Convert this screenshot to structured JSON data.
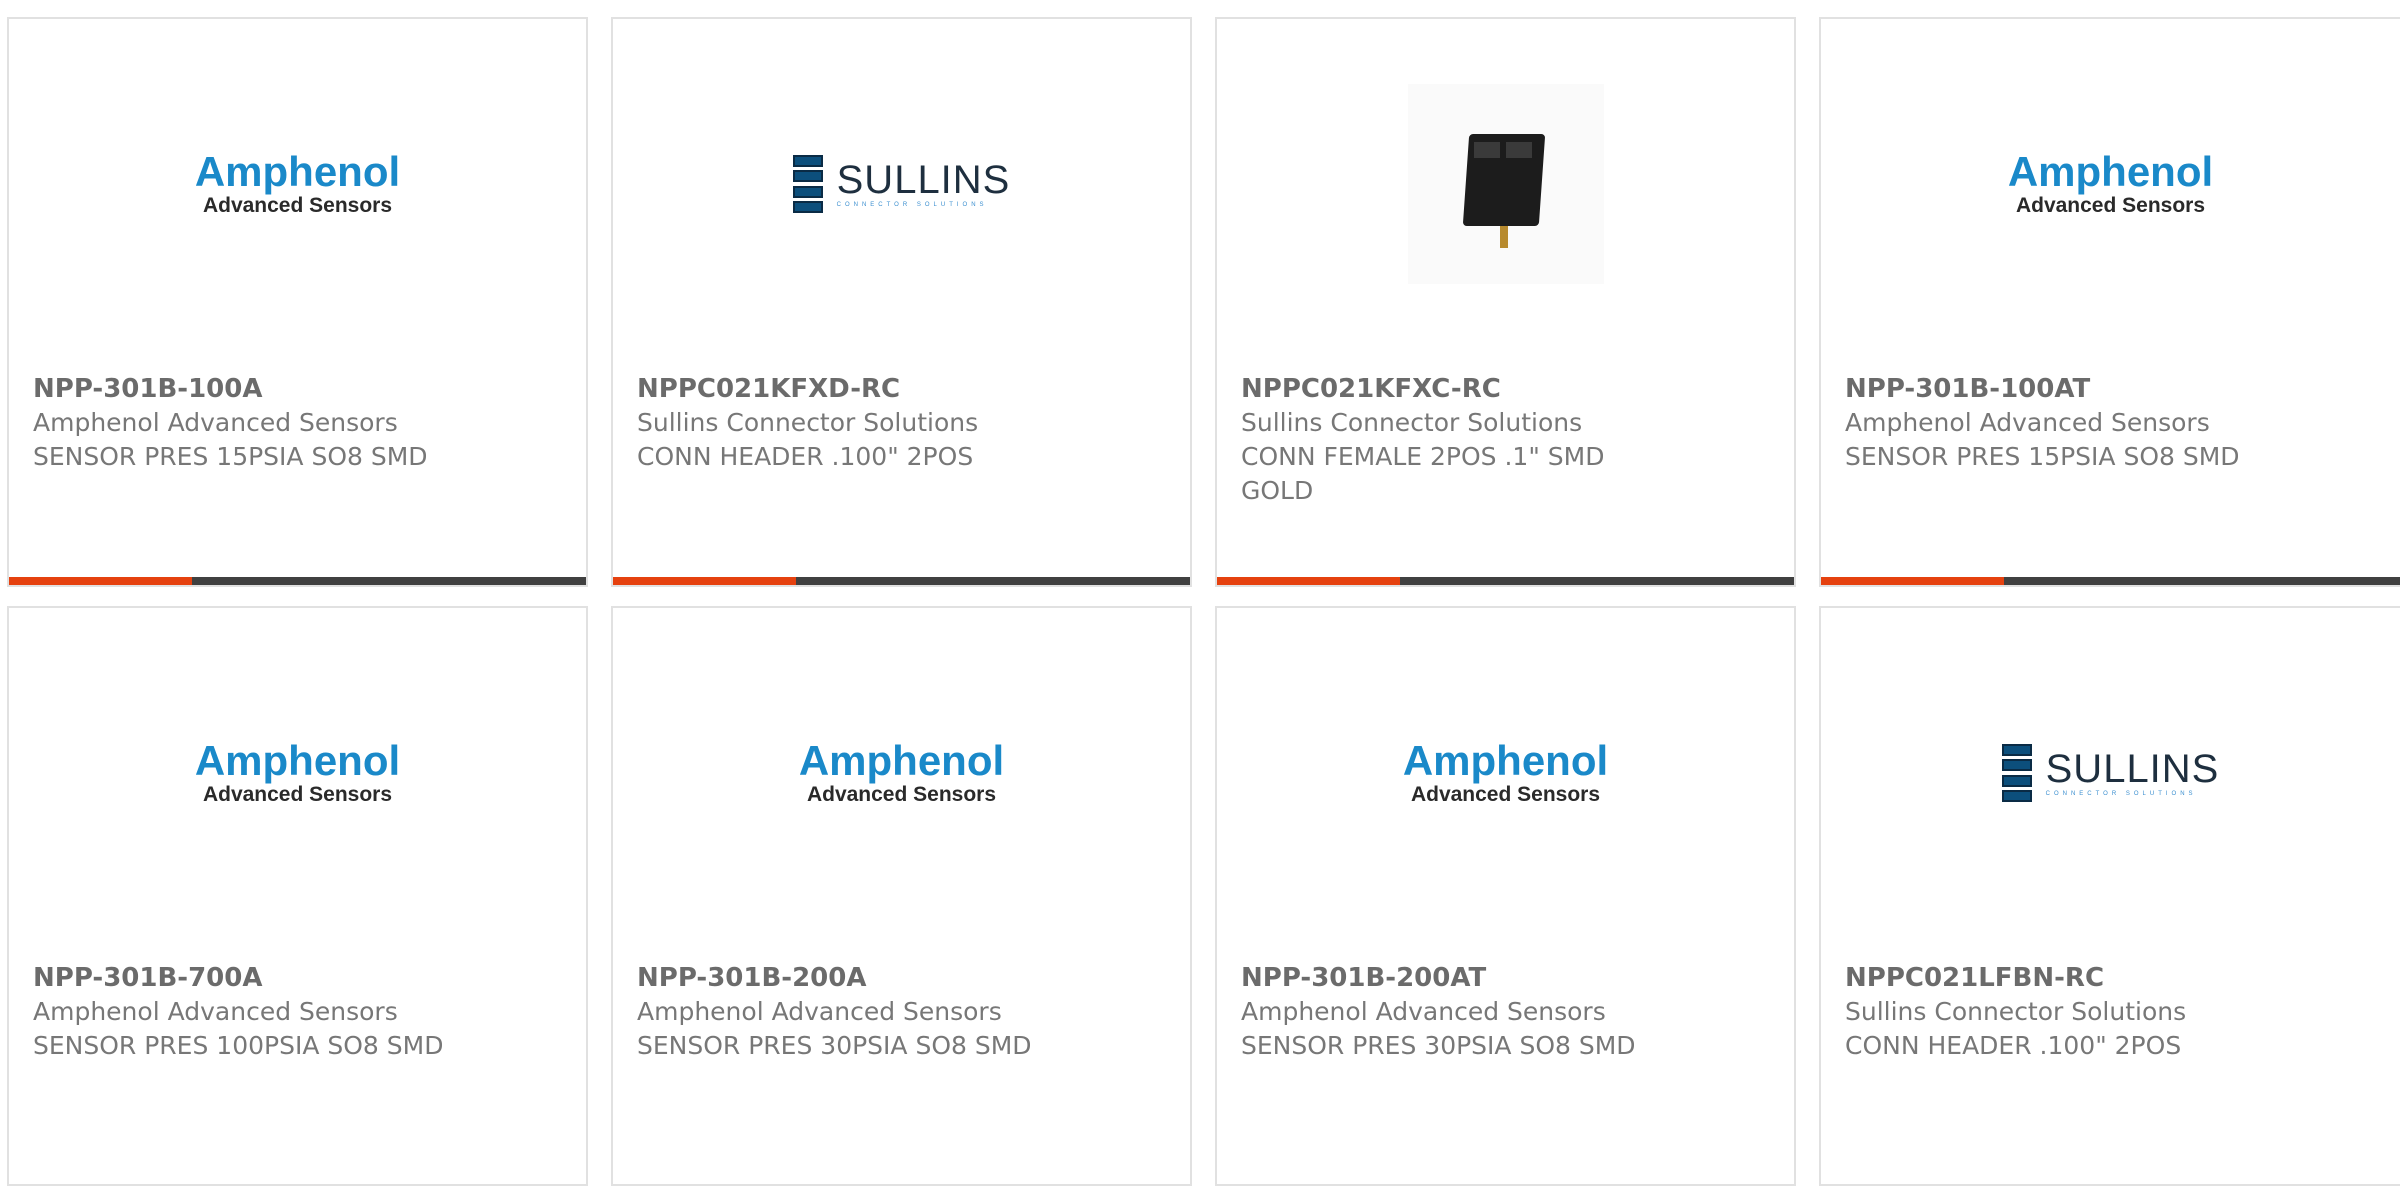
{
  "products": [
    {
      "part_number": "NPP-301B-100A",
      "manufacturer": "Amphenol Advanced Sensors",
      "description": "SENSOR PRES 15PSIA SO8 SMD",
      "image": "amphenol-logo"
    },
    {
      "part_number": "NPPC021KFXD-RC",
      "manufacturer": "Sullins Connector Solutions",
      "description": "CONN HEADER .100\" 2POS",
      "image": "sullins-logo"
    },
    {
      "part_number": "NPPC021KFXC-RC",
      "manufacturer": "Sullins Connector Solutions",
      "description": "CONN FEMALE 2POS .1\" SMD GOLD",
      "image": "connector-photo"
    },
    {
      "part_number": "NPP-301B-100AT",
      "manufacturer": "Amphenol Advanced Sensors",
      "description": "SENSOR PRES 15PSIA SO8 SMD",
      "image": "amphenol-logo"
    },
    {
      "part_number": "NPP-301B-700A",
      "manufacturer": "Amphenol Advanced Sensors",
      "description": "SENSOR PRES 100PSIA SO8 SMD",
      "image": "amphenol-logo"
    },
    {
      "part_number": "NPP-301B-200A",
      "manufacturer": "Amphenol Advanced Sensors",
      "description": "SENSOR PRES 30PSIA SO8 SMD",
      "image": "amphenol-logo"
    },
    {
      "part_number": "NPP-301B-200AT",
      "manufacturer": "Amphenol Advanced Sensors",
      "description": "SENSOR PRES 30PSIA SO8 SMD",
      "image": "amphenol-logo"
    },
    {
      "part_number": "NPPC021LFBN-RC",
      "manufacturer": "Sullins Connector Solutions",
      "description": "CONN HEADER .100\" 2POS",
      "image": "sullins-logo"
    }
  ],
  "logos": {
    "amphenol": {
      "line1": "Amphenol",
      "line2": "Advanced Sensors"
    },
    "sullins": {
      "line1": "SULLINS",
      "line2": "CONNECTOR SOLUTIONS"
    }
  },
  "colors": {
    "accent": "#e5410f",
    "bar": "#404040",
    "amphenol_blue": "#1a89c9",
    "text": "#777777"
  }
}
